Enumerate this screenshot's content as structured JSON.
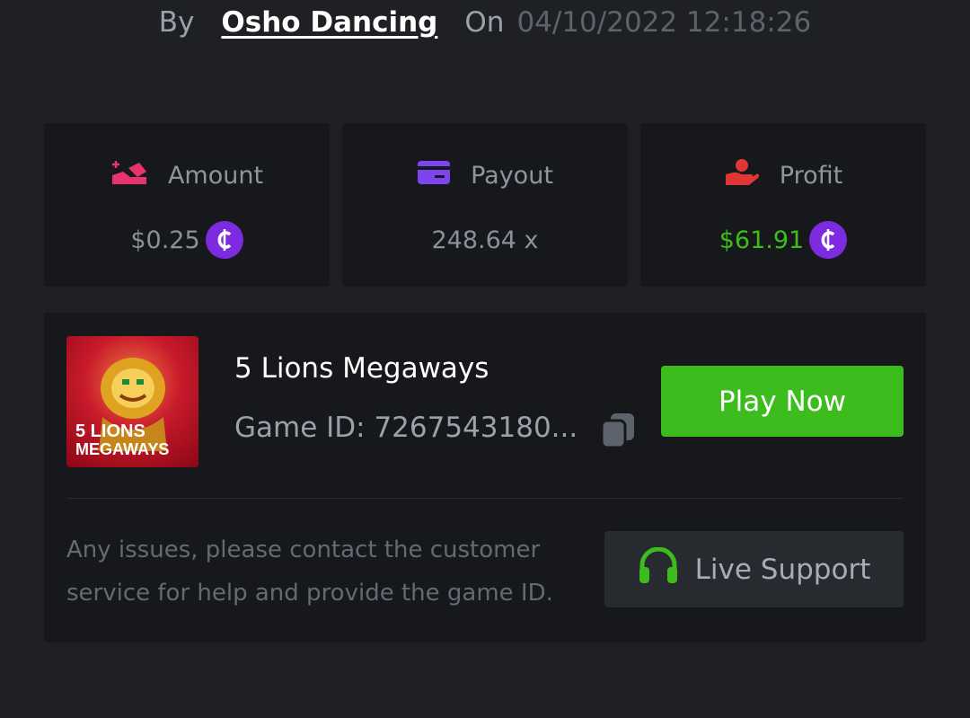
{
  "header": {
    "by_label": "By",
    "username": "Osho Dancing",
    "on_label": "On",
    "datetime": "04/10/2022 12:18:26"
  },
  "stats": {
    "amount": {
      "label": "Amount",
      "value": "$0.25",
      "icon": "bet-amount-icon",
      "icon_color": "#e8336e"
    },
    "payout": {
      "label": "Payout",
      "value": "248.64 x",
      "icon": "card-icon",
      "icon_color": "#7e44f0"
    },
    "profit": {
      "label": "Profit",
      "value": "$61.91",
      "icon": "hand-coin-icon",
      "icon_color": "#e03634",
      "value_color": "#3dbd1d"
    },
    "currency_glyph": "₵",
    "currency_color": "#7d2be1"
  },
  "game": {
    "title": "5 Lions Megaways",
    "id_text": "Game ID: 7267543180...",
    "thumb_text_line1": "5 LIONS",
    "thumb_text_line2": "MEGAWAYS",
    "play_label": "Play Now",
    "play_color": "#3dbd1d"
  },
  "support": {
    "notice": "Any issues, please contact the customer service for help and provide the game ID.",
    "button_label": "Live Support",
    "icon_color": "#3dbd1d"
  }
}
